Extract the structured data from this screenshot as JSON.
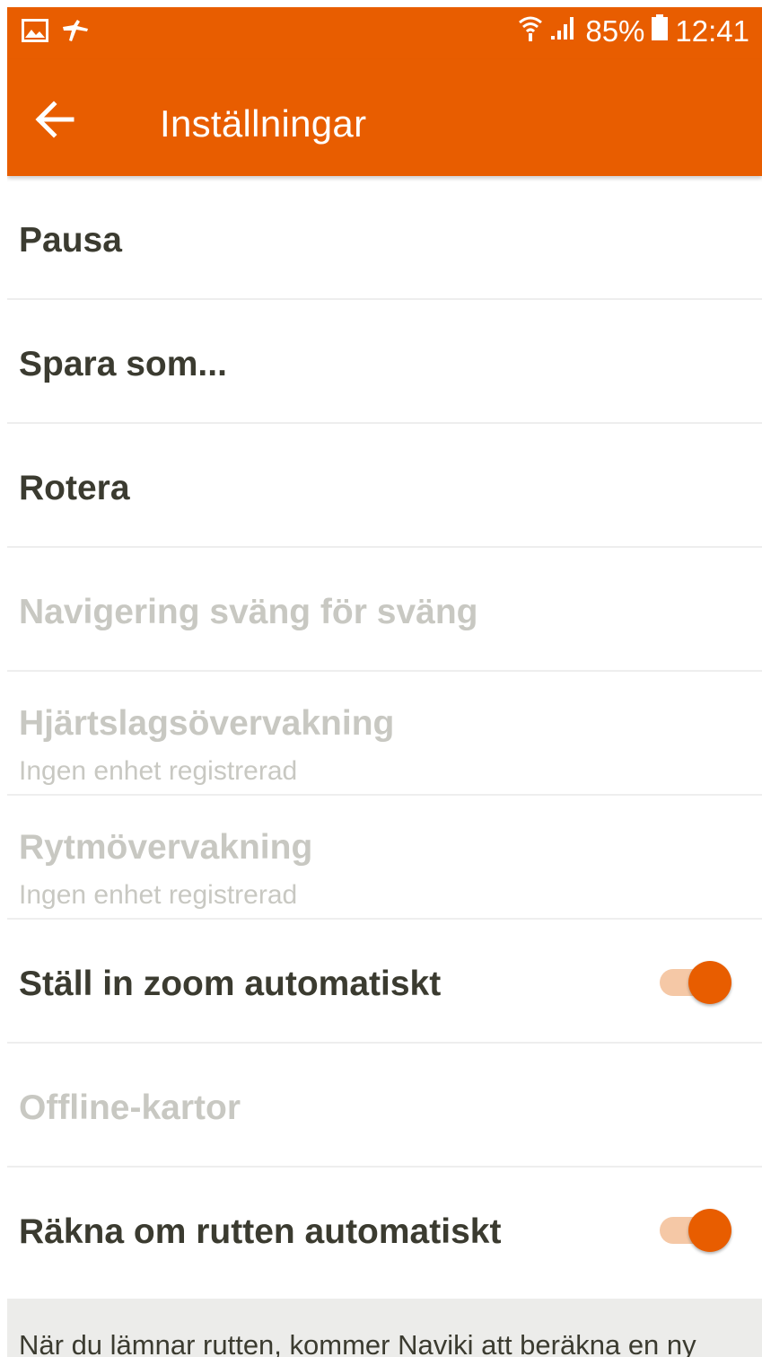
{
  "status_bar": {
    "icons_left": [
      "gallery-icon",
      "app-notification-icon"
    ],
    "icons_right": [
      "wifi-icon",
      "signal-icon",
      "battery-icon"
    ],
    "battery": "85%",
    "time": "12:41"
  },
  "app_bar": {
    "title": "Inställningar",
    "back_icon": "arrow-left-icon",
    "color": "#e85d00"
  },
  "settings": [
    {
      "label": "Pausa",
      "enabled": true
    },
    {
      "label": "Spara som...",
      "enabled": true
    },
    {
      "label": "Rotera",
      "enabled": true
    },
    {
      "label": "Navigering sväng för sväng",
      "enabled": false
    },
    {
      "label": "Hjärtslagsövervakning",
      "sublabel": "Ingen enhet registrerad",
      "enabled": false
    },
    {
      "label": "Rytmövervakning",
      "sublabel": "Ingen enhet registrerad",
      "enabled": false
    },
    {
      "label": "Ställ in zoom automatiskt",
      "enabled": true,
      "toggle": true
    },
    {
      "label": "Offline-kartor",
      "enabled": false
    },
    {
      "label": "Räkna om rutten automatiskt",
      "enabled": true,
      "toggle": true
    }
  ],
  "footer": {
    "text": "När du lämnar rutten, kommer Naviki att beräkna en ny"
  }
}
